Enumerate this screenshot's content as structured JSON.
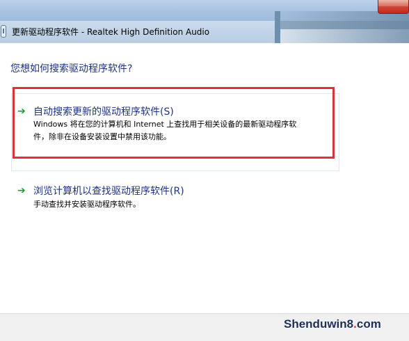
{
  "window": {
    "title": "更新驱动程序软件 - Realtek High Definition Audio"
  },
  "main": {
    "question": "您想如何搜索驱动程序软件?",
    "options": [
      {
        "icon": "green-arrow-icon",
        "title": "自动搜索更新的驱动程序软件(S)",
        "description_line1": "Windows 将在您的计算机和 Internet 上查找用于相关设备的最新驱动程序软",
        "description_line2": "件，除非在设备安装设置中禁用该功能。"
      },
      {
        "icon": "green-arrow-icon",
        "title": "浏览计算机以查找驱动程序软件(R)",
        "description_line1": "手动查找并安装驱动程序软件。"
      }
    ]
  },
  "watermark": {
    "text_main": "Shenduwin8",
    "text_dot": ".",
    "text_tail": "com"
  },
  "colors": {
    "link_blue": "#1e3287",
    "highlight_red": "#d9333b",
    "arrow_green": "#1a9a2f"
  }
}
